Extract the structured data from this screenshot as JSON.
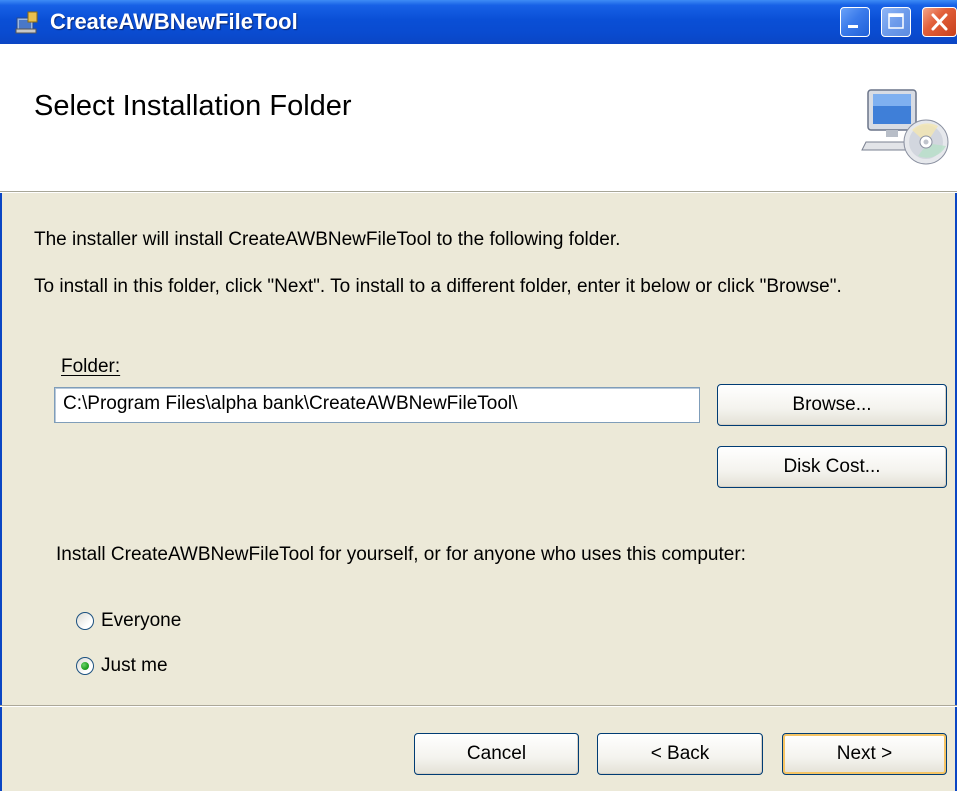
{
  "window": {
    "title": "CreateAWBNewFileTool",
    "controls": {
      "minimize": "minimize-icon",
      "maximize": "maximize-icon",
      "close": "close-icon"
    }
  },
  "header": {
    "title": "Select Installation Folder",
    "icon": "computer-cd-icon"
  },
  "body": {
    "line1": "The installer will install CreateAWBNewFileTool to the following folder.",
    "line2": "To install in this folder, click \"Next\". To install to a different folder, enter it below or click \"Browse\".",
    "folder_label": "Folder:",
    "folder_value": "C:\\Program Files\\alpha bank\\CreateAWBNewFileTool\\",
    "browse_label": "Browse...",
    "disk_cost_label": "Disk Cost...",
    "scope_prompt": "Install CreateAWBNewFileTool for yourself, or for anyone who uses this computer:",
    "options": [
      {
        "label": "Everyone",
        "selected": false
      },
      {
        "label": "Just me",
        "selected": true
      }
    ]
  },
  "footer": {
    "cancel_label": "Cancel",
    "back_label": "< Back",
    "next_label": "Next >"
  },
  "colors": {
    "titlebar": "#0A4FD6",
    "dialog_bg": "#ECE9D8",
    "banner_bg": "#FFFFFF",
    "default_button_highlight": "#F5C465",
    "radio_selected": "#21A121"
  }
}
